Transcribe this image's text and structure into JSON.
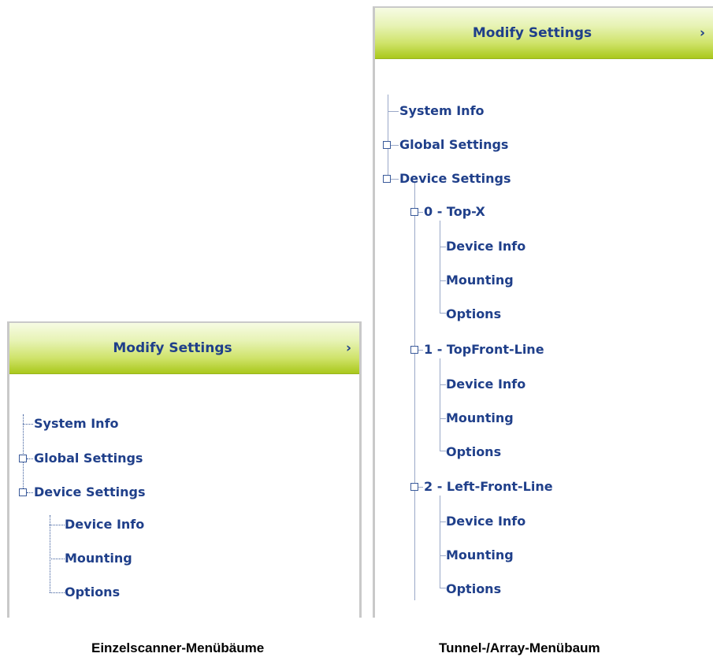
{
  "left_panel": {
    "header_title": "Modify Settings",
    "header_arrow": "›",
    "tree": {
      "system_info": "System Info",
      "global_settings": "Global Settings",
      "device_settings": "Device Settings",
      "device_info": "Device Info",
      "mounting": "Mounting",
      "options": "Options"
    }
  },
  "right_panel": {
    "header_title": "Modify Settings",
    "header_arrow": "›",
    "tree": {
      "system_info": "System Info",
      "global_settings": "Global Settings",
      "device_settings": "Device Settings",
      "devices": [
        {
          "name": "0 - Top-X",
          "children": [
            "Device Info",
            "Mounting",
            "Options"
          ]
        },
        {
          "name": "1 - TopFront-Line",
          "children": [
            "Device Info",
            "Mounting",
            "Options"
          ]
        },
        {
          "name": "2 - Left-Front-Line",
          "children": [
            "Device Info",
            "Mounting",
            "Options"
          ]
        }
      ]
    }
  },
  "captions": {
    "left": "Einzelscanner-Menübäume",
    "right": "Tunnel-/Array-Menübaum"
  }
}
